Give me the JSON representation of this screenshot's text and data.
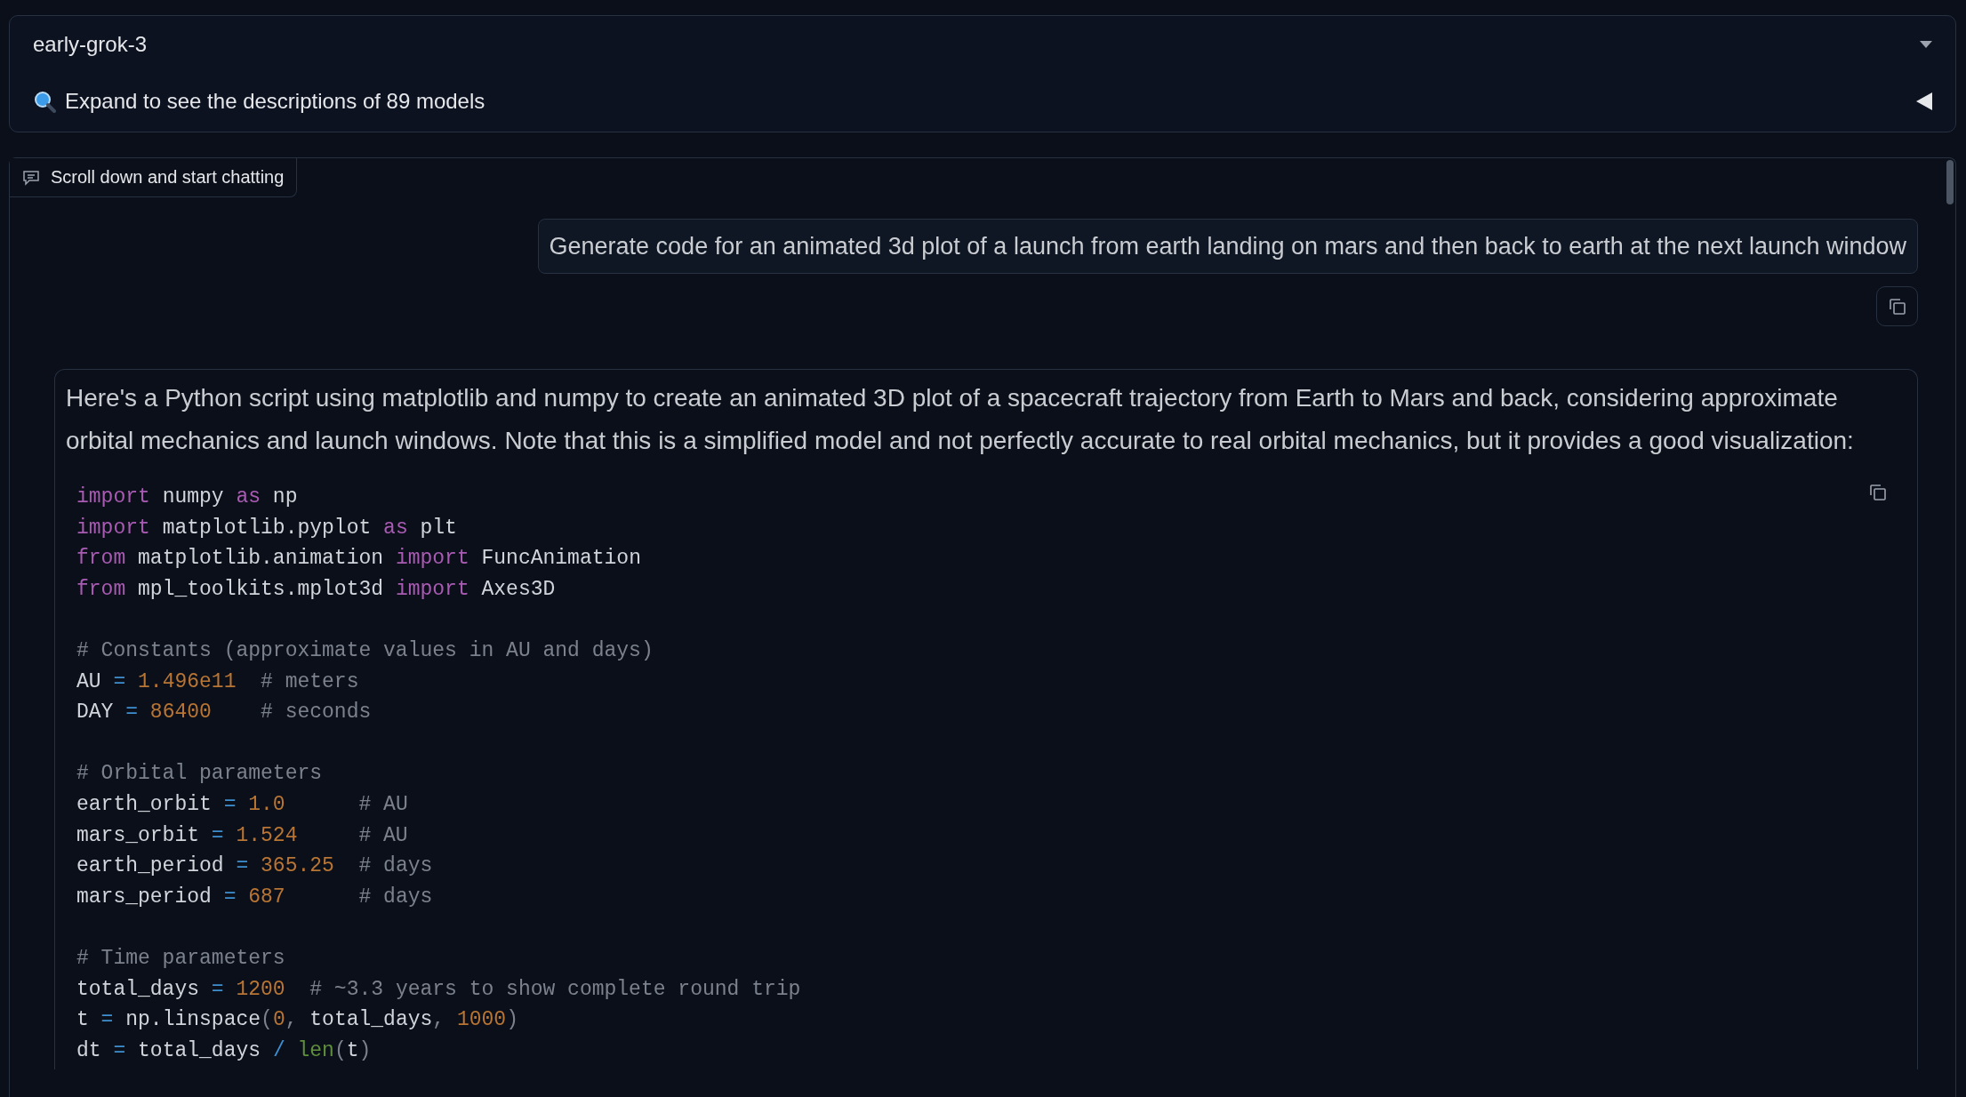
{
  "model_selector": {
    "value": "early-grok-3",
    "expand_label": "Expand to see the descriptions of 89 models"
  },
  "chat": {
    "tab_label": "Scroll down and start chatting",
    "messages": [
      {
        "kind": "user",
        "text": "Generate code for an animated 3d plot of a launch from earth landing on mars and then back to earth at the next launch window"
      },
      {
        "kind": "assistant",
        "text": "Here's a Python script using matplotlib and numpy to create an animated 3D plot of a spacecraft trajectory from Earth to Mars and back, considering approximate orbital mechanics and launch windows. Note that this is a simplified model and not perfectly accurate to real orbital mechanics, but it provides a good visualization:",
        "code": [
          {
            "kind": "code",
            "tokens": [
              {
                "kind": "kw",
                "text": "import"
              },
              {
                "kind": "plain",
                "text": " numpy "
              },
              {
                "kind": "kw",
                "text": "as"
              },
              {
                "kind": "plain",
                "text": " np"
              }
            ]
          },
          {
            "kind": "code",
            "tokens": [
              {
                "kind": "kw",
                "text": "import"
              },
              {
                "kind": "plain",
                "text": " matplotlib.pyplot "
              },
              {
                "kind": "kw",
                "text": "as"
              },
              {
                "kind": "plain",
                "text": " plt"
              }
            ]
          },
          {
            "kind": "code",
            "tokens": [
              {
                "kind": "kw",
                "text": "from"
              },
              {
                "kind": "plain",
                "text": " matplotlib.animation "
              },
              {
                "kind": "kw",
                "text": "import"
              },
              {
                "kind": "plain",
                "text": " FuncAnimation"
              }
            ]
          },
          {
            "kind": "code",
            "tokens": [
              {
                "kind": "kw",
                "text": "from"
              },
              {
                "kind": "plain",
                "text": " mpl_toolkits.mplot3d "
              },
              {
                "kind": "kw",
                "text": "import"
              },
              {
                "kind": "plain",
                "text": " Axes3D"
              }
            ]
          },
          {
            "kind": "blank"
          },
          {
            "kind": "code",
            "tokens": [
              {
                "kind": "com",
                "text": "# Constants (approximate values in AU and days)"
              }
            ]
          },
          {
            "kind": "code",
            "tokens": [
              {
                "kind": "plain",
                "text": "AU "
              },
              {
                "kind": "op",
                "text": "= "
              },
              {
                "kind": "num",
                "text": "1.496e11"
              },
              {
                "kind": "com",
                "text": "  # meters"
              }
            ]
          },
          {
            "kind": "code",
            "tokens": [
              {
                "kind": "plain",
                "text": "DAY "
              },
              {
                "kind": "op",
                "text": "= "
              },
              {
                "kind": "num",
                "text": "86400"
              },
              {
                "kind": "com",
                "text": "    # seconds"
              }
            ]
          },
          {
            "kind": "blank"
          },
          {
            "kind": "code",
            "tokens": [
              {
                "kind": "com",
                "text": "# Orbital parameters"
              }
            ]
          },
          {
            "kind": "code",
            "tokens": [
              {
                "kind": "plain",
                "text": "earth_orbit "
              },
              {
                "kind": "op",
                "text": "= "
              },
              {
                "kind": "num",
                "text": "1.0"
              },
              {
                "kind": "com",
                "text": "      # AU"
              }
            ]
          },
          {
            "kind": "code",
            "tokens": [
              {
                "kind": "plain",
                "text": "mars_orbit "
              },
              {
                "kind": "op",
                "text": "= "
              },
              {
                "kind": "num",
                "text": "1.524"
              },
              {
                "kind": "com",
                "text": "     # AU"
              }
            ]
          },
          {
            "kind": "code",
            "tokens": [
              {
                "kind": "plain",
                "text": "earth_period "
              },
              {
                "kind": "op",
                "text": "= "
              },
              {
                "kind": "num",
                "text": "365.25"
              },
              {
                "kind": "com",
                "text": "  # days"
              }
            ]
          },
          {
            "kind": "code",
            "tokens": [
              {
                "kind": "plain",
                "text": "mars_period "
              },
              {
                "kind": "op",
                "text": "= "
              },
              {
                "kind": "num",
                "text": "687"
              },
              {
                "kind": "com",
                "text": "      # days"
              }
            ]
          },
          {
            "kind": "blank"
          },
          {
            "kind": "code",
            "tokens": [
              {
                "kind": "com",
                "text": "# Time parameters"
              }
            ]
          },
          {
            "kind": "code",
            "tokens": [
              {
                "kind": "plain",
                "text": "total_days "
              },
              {
                "kind": "op",
                "text": "= "
              },
              {
                "kind": "num",
                "text": "1200"
              },
              {
                "kind": "com",
                "text": "  # ~3.3 years to show complete round trip"
              }
            ]
          },
          {
            "kind": "code",
            "tokens": [
              {
                "kind": "plain",
                "text": "t "
              },
              {
                "kind": "op",
                "text": "="
              },
              {
                "kind": "plain",
                "text": " np.linspace"
              },
              {
                "kind": "punct",
                "text": "("
              },
              {
                "kind": "num",
                "text": "0"
              },
              {
                "kind": "punct",
                "text": ", "
              },
              {
                "kind": "plain",
                "text": "total_days"
              },
              {
                "kind": "punct",
                "text": ", "
              },
              {
                "kind": "num",
                "text": "1000"
              },
              {
                "kind": "punct",
                "text": ")"
              }
            ]
          },
          {
            "kind": "code",
            "tokens": [
              {
                "kind": "plain",
                "text": "dt "
              },
              {
                "kind": "op",
                "text": "="
              },
              {
                "kind": "plain",
                "text": " total_days "
              },
              {
                "kind": "op",
                "text": "/ "
              },
              {
                "kind": "fn",
                "text": "len"
              },
              {
                "kind": "punct",
                "text": "("
              },
              {
                "kind": "plain",
                "text": "t"
              },
              {
                "kind": "punct",
                "text": ")"
              }
            ]
          }
        ]
      }
    ]
  }
}
